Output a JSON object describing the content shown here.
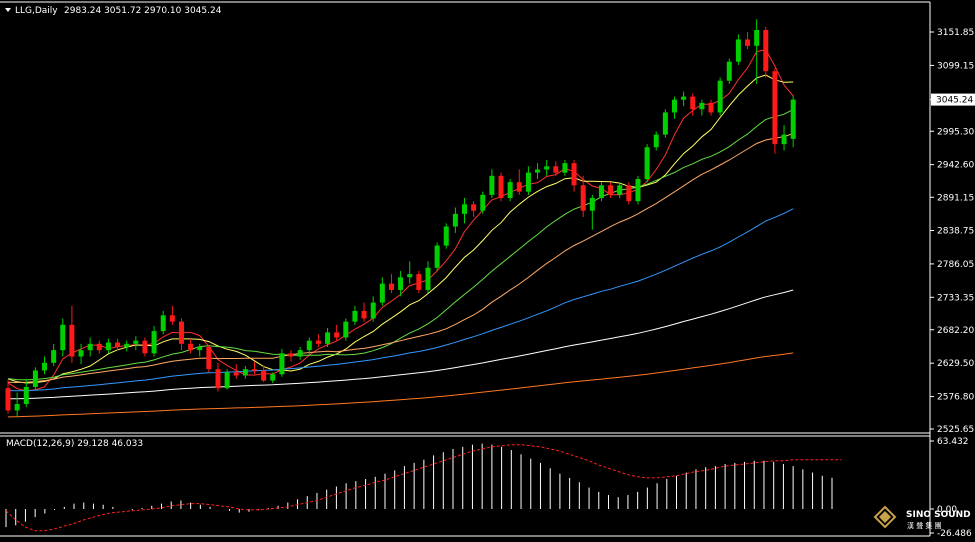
{
  "header": {
    "symbol": "LLG,Daily",
    "ohlc": "2983.24 3051.72 2970.10 3045.24"
  },
  "macd_header": "MACD(12,26,9) 29.128 46.033",
  "watermark": {
    "en": "SINO SOUND",
    "cn": "漢 聲 集 團"
  },
  "colors": {
    "up": "#00d000",
    "down": "#ff1a1a",
    "bg": "#000000",
    "grid": "#ffffff",
    "ma5": "#ff3030",
    "ma10": "#ffff66",
    "ma20": "#66dd44",
    "ma30": "#ffaa66",
    "ma60": "#3399ff",
    "ma120": "#ffffff",
    "ma250": "#ff7722",
    "signal": "#ff2020"
  },
  "chart_data": [
    {
      "type": "candlestick",
      "title": "LLG,Daily",
      "y_ticks": [
        "3151.85",
        "3099.15",
        "3045.24",
        "2995.30",
        "2942.60",
        "2891.15",
        "2838.75",
        "2786.05",
        "2733.35",
        "2682.20",
        "2629.50",
        "2576.80",
        "2525.65"
      ],
      "current_price": "3045.24",
      "ylim": [
        2525.65,
        3174
      ],
      "candles": [
        [
          2590,
          2603,
          2550,
          2555
        ],
        [
          2555,
          2583,
          2545,
          2565
        ],
        [
          2565,
          2605,
          2560,
          2592
        ],
        [
          2592,
          2623,
          2588,
          2618
        ],
        [
          2618,
          2640,
          2612,
          2630
        ],
        [
          2630,
          2660,
          2625,
          2650
        ],
        [
          2650,
          2700,
          2640,
          2690
        ],
        [
          2690,
          2720,
          2630,
          2640
        ],
        [
          2640,
          2660,
          2628,
          2650
        ],
        [
          2650,
          2670,
          2640,
          2660
        ],
        [
          2660,
          2665,
          2645,
          2650
        ],
        [
          2650,
          2668,
          2645,
          2662
        ],
        [
          2662,
          2668,
          2650,
          2655
        ],
        [
          2655,
          2665,
          2648,
          2660
        ],
        [
          2660,
          2672,
          2650,
          2665
        ],
        [
          2665,
          2670,
          2640,
          2645
        ],
        [
          2645,
          2688,
          2640,
          2680
        ],
        [
          2680,
          2712,
          2675,
          2705
        ],
        [
          2705,
          2720,
          2690,
          2695
        ],
        [
          2695,
          2700,
          2650,
          2660
        ],
        [
          2660,
          2668,
          2645,
          2650
        ],
        [
          2650,
          2660,
          2640,
          2655
        ],
        [
          2655,
          2658,
          2615,
          2620
        ],
        [
          2620,
          2630,
          2585,
          2590
        ],
        [
          2590,
          2620,
          2588,
          2615
        ],
        [
          2615,
          2628,
          2605,
          2610
        ],
        [
          2610,
          2625,
          2605,
          2620
        ],
        [
          2620,
          2632,
          2612,
          2618
        ],
        [
          2618,
          2625,
          2600,
          2602
        ],
        [
          2602,
          2615,
          2598,
          2612
        ],
        [
          2612,
          2652,
          2608,
          2645
        ],
        [
          2645,
          2650,
          2632,
          2640
        ],
        [
          2640,
          2655,
          2635,
          2650
        ],
        [
          2650,
          2670,
          2642,
          2665
        ],
        [
          2665,
          2675,
          2655,
          2660
        ],
        [
          2660,
          2685,
          2655,
          2678
        ],
        [
          2678,
          2690,
          2665,
          2670
        ],
        [
          2670,
          2700,
          2665,
          2695
        ],
        [
          2695,
          2720,
          2690,
          2712
        ],
        [
          2712,
          2725,
          2695,
          2700
        ],
        [
          2700,
          2735,
          2695,
          2725
        ],
        [
          2725,
          2765,
          2720,
          2755
        ],
        [
          2755,
          2770,
          2740,
          2745
        ],
        [
          2745,
          2775,
          2735,
          2765
        ],
        [
          2765,
          2790,
          2755,
          2770
        ],
        [
          2770,
          2775,
          2740,
          2745
        ],
        [
          2745,
          2790,
          2740,
          2780
        ],
        [
          2780,
          2820,
          2775,
          2815
        ],
        [
          2815,
          2850,
          2810,
          2845
        ],
        [
          2845,
          2875,
          2835,
          2865
        ],
        [
          2865,
          2890,
          2850,
          2880
        ],
        [
          2880,
          2885,
          2860,
          2870
        ],
        [
          2870,
          2900,
          2865,
          2895
        ],
        [
          2895,
          2935,
          2890,
          2925
        ],
        [
          2925,
          2930,
          2885,
          2890
        ],
        [
          2890,
          2920,
          2885,
          2915
        ],
        [
          2915,
          2935,
          2895,
          2900
        ],
        [
          2900,
          2940,
          2895,
          2930
        ],
        [
          2930,
          2945,
          2920,
          2935
        ],
        [
          2935,
          2950,
          2925,
          2940
        ],
        [
          2940,
          2948,
          2925,
          2930
        ],
        [
          2930,
          2950,
          2925,
          2945
        ],
        [
          2945,
          2950,
          2900,
          2910
        ],
        [
          2910,
          2925,
          2860,
          2870
        ],
        [
          2870,
          2895,
          2840,
          2890
        ],
        [
          2890,
          2915,
          2885,
          2910
        ],
        [
          2910,
          2915,
          2890,
          2895
        ],
        [
          2895,
          2915,
          2890,
          2910
        ],
        [
          2910,
          2915,
          2880,
          2885
        ],
        [
          2885,
          2925,
          2880,
          2920
        ],
        [
          2920,
          2975,
          2915,
          2970
        ],
        [
          2970,
          2995,
          2965,
          2990
        ],
        [
          2990,
          3030,
          2985,
          3025
        ],
        [
          3025,
          3050,
          3015,
          3045
        ],
        [
          3045,
          3058,
          3035,
          3050
        ],
        [
          3050,
          3055,
          3020,
          3030
        ],
        [
          3030,
          3045,
          3020,
          3040
        ],
        [
          3040,
          3045,
          3020,
          3025
        ],
        [
          3025,
          3080,
          3020,
          3075
        ],
        [
          3075,
          3110,
          3070,
          3105
        ],
        [
          3105,
          3148,
          3100,
          3140
        ],
        [
          3140,
          3152,
          3125,
          3130
        ],
        [
          3130,
          3172,
          3070,
          3155
        ],
        [
          3155,
          3160,
          3080,
          3090
        ],
        [
          3090,
          3095,
          2960,
          2975
        ],
        [
          2975,
          3005,
          2965,
          2990
        ],
        [
          2983.24,
          3051.72,
          2970.1,
          3045.24
        ]
      ],
      "ma_series": [
        "MA5",
        "MA10",
        "MA20",
        "MA30",
        "MA60",
        "MA120",
        "MA250"
      ]
    },
    {
      "type": "bar",
      "title": "MACD(12,26,9) 29.128 46.033",
      "y_ticks": [
        "63.432",
        "0.00",
        "-26.486"
      ],
      "ylim": [
        -26.486,
        63.432
      ],
      "macd_values": [
        -20,
        -18,
        -14,
        -9,
        -5,
        -1,
        2,
        5,
        6,
        5,
        4,
        2,
        0,
        -1,
        1,
        3,
        5,
        7,
        8,
        6,
        4,
        2,
        0,
        -2,
        -4,
        -3,
        -1,
        1,
        3,
        6,
        9,
        12,
        15,
        18,
        21,
        24,
        26,
        28,
        30,
        33,
        36,
        40,
        43,
        46,
        50,
        53,
        56,
        58,
        60,
        61,
        60,
        58,
        55,
        51,
        47,
        43,
        38,
        33,
        29,
        25,
        20,
        16,
        13,
        11,
        13,
        16,
        20,
        24,
        28,
        31,
        34,
        37,
        39,
        40,
        42,
        43,
        44,
        45,
        45,
        44,
        42,
        40,
        37,
        34,
        31,
        29.128
      ],
      "signal_values": [
        -2,
        -12,
        -20,
        -24,
        -24,
        -22,
        -19,
        -16,
        -12,
        -9,
        -6,
        -4,
        -3,
        -2,
        -1,
        0,
        1,
        3,
        4,
        5,
        5,
        4,
        3,
        2,
        0,
        -1,
        -1,
        0,
        1,
        2,
        4,
        6,
        8,
        11,
        14,
        17,
        20,
        22,
        25,
        27,
        30,
        33,
        36,
        39,
        42,
        45,
        48,
        51,
        54,
        56,
        58,
        59,
        60,
        60,
        59,
        58,
        56,
        54,
        51,
        48,
        45,
        41,
        38,
        35,
        32,
        30,
        29,
        29,
        30,
        31,
        33,
        35,
        36,
        38,
        40,
        41,
        42,
        43,
        44,
        45,
        45,
        46,
        46,
        46,
        46,
        46,
        46.033
      ]
    }
  ]
}
